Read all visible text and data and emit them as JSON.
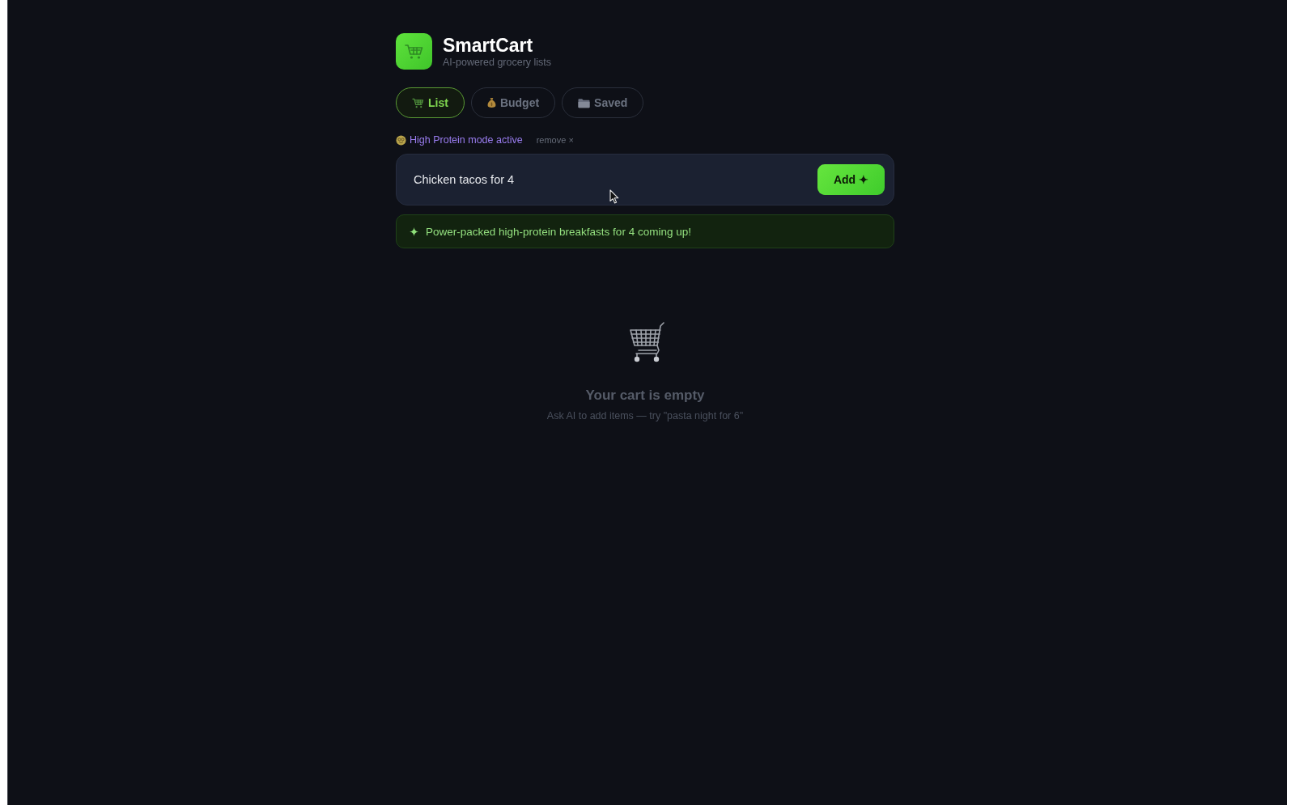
{
  "app": {
    "title": "SmartCart",
    "subtitle": "AI-powered grocery lists"
  },
  "tabs": [
    {
      "label": "List",
      "selected": true
    },
    {
      "label": "Budget",
      "selected": false
    },
    {
      "label": "Saved",
      "selected": false
    }
  ],
  "mode": {
    "label": "High Protein mode active",
    "remove": "remove ×"
  },
  "prompt": {
    "value": "Chicken tacos for 4",
    "button": "Add ✦"
  },
  "notice": {
    "text": "Power-packed high-protein breakfasts for 4 coming up!"
  },
  "empty_state": {
    "title": "Your cart is empty",
    "hint": "Ask AI to add items — try \"pasta night for 6\""
  }
}
